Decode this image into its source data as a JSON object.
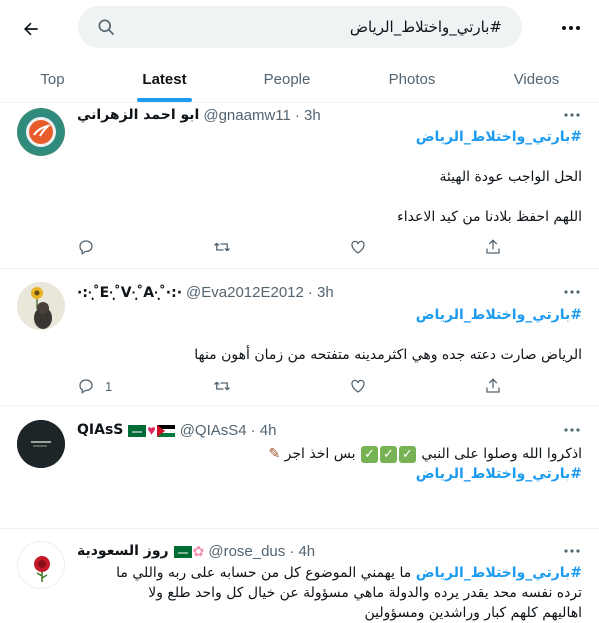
{
  "search": {
    "query": "#بارتي_واختلاط_الرياض"
  },
  "tabs": [
    "Top",
    "Latest",
    "People",
    "Photos",
    "Videos"
  ],
  "active_tab": "Latest",
  "tweets": [
    {
      "name": "ابو احمد الزهراني",
      "handle": "@gnaamw11",
      "time": "· 3h",
      "hashtag": "#بارتي_واختلاط_الرياض",
      "lines": [
        "الحل الواجب عودة الهيئة",
        "اللهم احفظ بلادنا من كيد الاعداء"
      ],
      "reply_count": "",
      "avatar_color": "#1a7a6b"
    },
    {
      "name": "·:·̩͙˚E·̩͙˚V·̩͙˚A·̩͙˚·:·",
      "handle": "@Eva2012E2012",
      "time": "· 3h",
      "hashtag": "#بارتي_واختلاط_الرياض",
      "lines": [
        "الرياض صارت دعته جده وهي اكثرمدينه متفتحه من زمان أهون منها"
      ],
      "reply_count": "1",
      "avatar_color": "#d8cdb4"
    },
    {
      "name": "QIAsS",
      "handle": "@QIAsS4",
      "time": "· 4h",
      "lines": [
        "اذكروا الله وصلوا على النبي",
        "بس اخذ اجر"
      ],
      "hashtag": "#بارتي_واختلاط_الرياض",
      "reply_count": "",
      "avatar_color": "#1f2a2e"
    },
    {
      "name": "روز السعودية",
      "handle": "@rose_dus",
      "time": "· 4h",
      "hashtag": "#بارتي_واختلاط_الرياض",
      "lines": [
        " ما يهمني الموضوع كل من حسابه على ربه واللي ما",
        "ترده نفسه محد يقدر يرده والدولة ماهي مسؤولة عن خيال كل واحد طلع ولا",
        "اهاليهم كلهم كبار وراشدين ومسؤولين"
      ],
      "reply_count": "",
      "avatar_color": "#ffffff"
    }
  ],
  "colors": {
    "accent": "#1d9bf0",
    "text": "#0f1419",
    "secondary": "#536471",
    "divider": "#eff3f4"
  },
  "icons": [
    "back-arrow-icon",
    "search-icon",
    "more-icon",
    "reply-icon",
    "retweet-icon",
    "like-icon",
    "share-icon"
  ]
}
